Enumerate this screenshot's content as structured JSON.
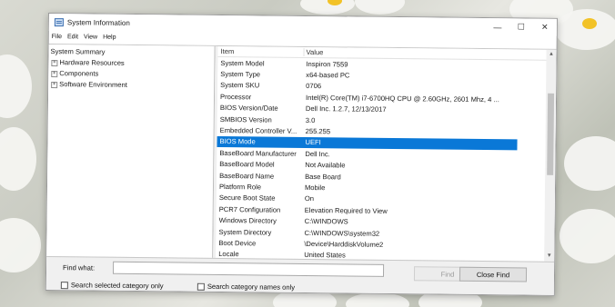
{
  "window": {
    "title": "System Information",
    "controls": {
      "minimize": "—",
      "maximize": "☐",
      "close": "✕"
    }
  },
  "menu": [
    "File",
    "Edit",
    "View",
    "Help"
  ],
  "tree": {
    "root": "System Summary",
    "children": [
      {
        "label": "Hardware Resources",
        "expander": "+"
      },
      {
        "label": "Components",
        "expander": "+"
      },
      {
        "label": "Software Environment",
        "expander": "+"
      }
    ]
  },
  "list": {
    "headers": {
      "item": "Item",
      "value": "Value"
    },
    "rows": [
      {
        "item": "System Model",
        "value": "Inspiron 7559"
      },
      {
        "item": "System Type",
        "value": "x64-based PC"
      },
      {
        "item": "System SKU",
        "value": "0706"
      },
      {
        "item": "Processor",
        "value": "Intel(R) Core(TM) i7-6700HQ CPU @ 2.60GHz, 2601 Mhz, 4 ..."
      },
      {
        "item": "BIOS Version/Date",
        "value": "Dell Inc. 1.2.7, 12/13/2017"
      },
      {
        "item": "SMBIOS Version",
        "value": "3.0"
      },
      {
        "item": "Embedded Controller V...",
        "value": "255.255"
      },
      {
        "item": "BIOS Mode",
        "value": "UEFI",
        "selected": true
      },
      {
        "item": "BaseBoard Manufacturer",
        "value": "Dell Inc."
      },
      {
        "item": "BaseBoard Model",
        "value": "Not Available"
      },
      {
        "item": "BaseBoard Name",
        "value": "Base Board"
      },
      {
        "item": "Platform Role",
        "value": "Mobile"
      },
      {
        "item": "Secure Boot State",
        "value": "On"
      },
      {
        "item": "PCR7 Configuration",
        "value": "Elevation Required to View"
      },
      {
        "item": "Windows Directory",
        "value": "C:\\WINDOWS"
      },
      {
        "item": "System Directory",
        "value": "C:\\WINDOWS\\system32"
      },
      {
        "item": "Boot Device",
        "value": "\\Device\\HarddiskVolume2"
      },
      {
        "item": "Locale",
        "value": "United States"
      }
    ]
  },
  "find": {
    "label": "Find what:",
    "value": "",
    "find_button": "Find",
    "close_button": "Close Find",
    "search_selected": "Search selected category only",
    "search_names": "Search category names only"
  },
  "colors": {
    "selection": "#0a78d7"
  }
}
